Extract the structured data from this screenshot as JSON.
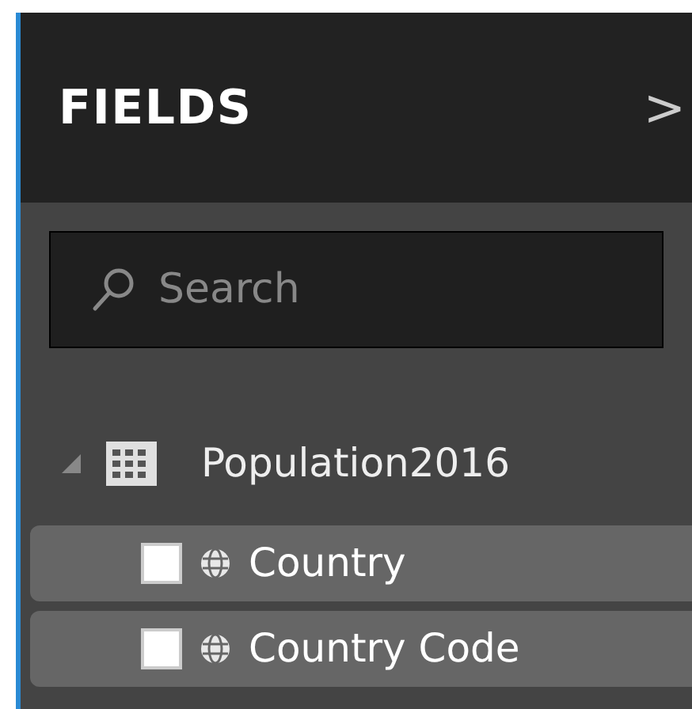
{
  "header": {
    "title": "FIELDS",
    "collapse_glyph": ">"
  },
  "search": {
    "placeholder": "Search"
  },
  "tables": [
    {
      "name": "Population2016",
      "expanded": true,
      "fields": [
        {
          "name": "Country",
          "checked": false
        },
        {
          "name": "Country Code",
          "checked": false
        }
      ]
    }
  ]
}
